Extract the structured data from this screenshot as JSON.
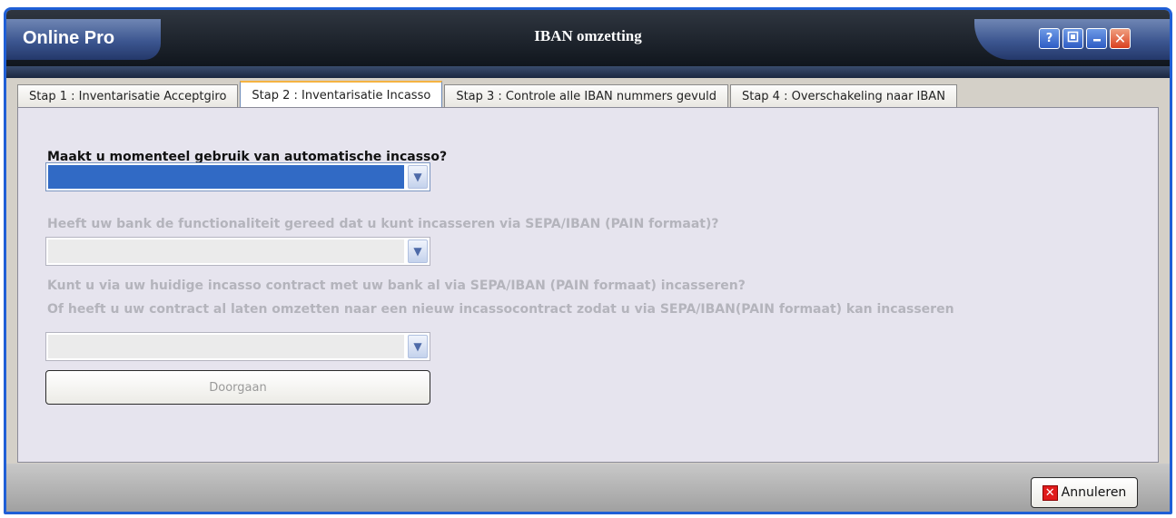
{
  "app": {
    "brand": "Online Pro",
    "window_title": "IBAN omzetting"
  },
  "title_controls": {
    "help_icon": "?",
    "close_icon": "✕"
  },
  "tabs": [
    {
      "label": "Stap 1 : Inventarisatie Acceptgiro",
      "active": false
    },
    {
      "label": "Stap 2 : Inventarisatie Incasso",
      "active": true
    },
    {
      "label": "Stap 3 : Controle alle IBAN nummers gevuld",
      "active": false
    },
    {
      "label": "Stap 4 : Overschakeling naar IBAN",
      "active": false
    }
  ],
  "form": {
    "question1": "Maakt u momenteel gebruik van automatische incasso?",
    "question2": "Heeft uw bank de functionaliteit gereed dat u kunt incasseren via SEPA/IBAN (PAIN formaat)?",
    "question3_line1": "Kunt u via uw huidige incasso contract met uw bank al via SEPA/IBAN (PAIN formaat) incasseren?",
    "question3_line2": "Of heeft u uw contract al laten omzetten naar een nieuw incassocontract zodat u via SEPA/IBAN(PAIN formaat) kan incasseren",
    "continue_label": "Doorgaan"
  },
  "footer": {
    "cancel_label": "Annuleren"
  },
  "colors": {
    "accent": "#316ac5",
    "window_border": "#1f5fd6",
    "disabled_text": "#b4b4bc"
  }
}
